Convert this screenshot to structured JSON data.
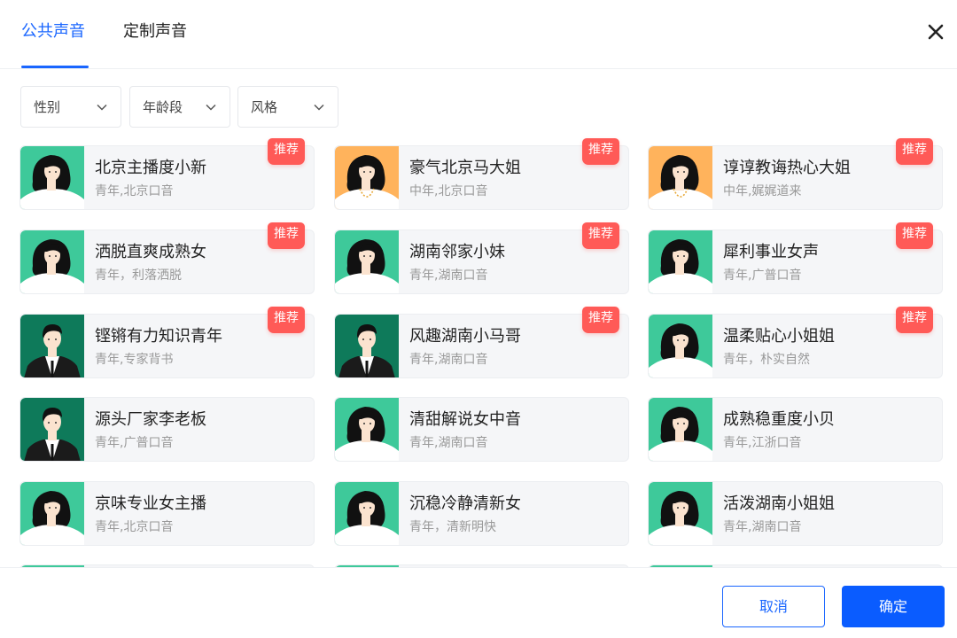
{
  "tabs": [
    {
      "label": "公共声音",
      "active": true
    },
    {
      "label": "定制声音",
      "active": false
    }
  ],
  "filters": [
    {
      "label": "性别"
    },
    {
      "label": "年龄段"
    },
    {
      "label": "风格"
    }
  ],
  "badge_text": "推荐",
  "voices": [
    {
      "name": "北京主播度小新",
      "desc": "青年,北京口音",
      "avatar": "young-woman",
      "recommended": true
    },
    {
      "name": "豪气北京马大姐",
      "desc": "中年,北京口音",
      "avatar": "middle-woman",
      "recommended": true
    },
    {
      "name": "谆谆教诲热心大姐",
      "desc": "中年,娓娓道来",
      "avatar": "middle-woman",
      "recommended": true
    },
    {
      "name": "洒脱直爽成熟女",
      "desc": "青年，利落洒脱",
      "avatar": "young-woman",
      "recommended": true
    },
    {
      "name": "湖南邻家小妹",
      "desc": "青年,湖南口音",
      "avatar": "young-woman",
      "recommended": true
    },
    {
      "name": "犀利事业女声",
      "desc": "青年,广普口音",
      "avatar": "young-woman",
      "recommended": true
    },
    {
      "name": "铿锵有力知识青年",
      "desc": "青年,专家背书",
      "avatar": "young-man",
      "recommended": true
    },
    {
      "name": "风趣湖南小马哥",
      "desc": "青年,湖南口音",
      "avatar": "young-man",
      "recommended": true
    },
    {
      "name": "温柔贴心小姐姐",
      "desc": "青年，朴实自然",
      "avatar": "young-woman",
      "recommended": true
    },
    {
      "name": "源头厂家李老板",
      "desc": "青年,广普口音",
      "avatar": "young-man",
      "recommended": false
    },
    {
      "name": "清甜解说女中音",
      "desc": "青年,湖南口音",
      "avatar": "young-woman",
      "recommended": false
    },
    {
      "name": "成熟稳重度小贝",
      "desc": "青年,江浙口音",
      "avatar": "young-woman",
      "recommended": false
    },
    {
      "name": "京味专业女主播",
      "desc": "青年,北京口音",
      "avatar": "young-woman",
      "recommended": false
    },
    {
      "name": "沉稳冷静清新女",
      "desc": "青年，清新明快",
      "avatar": "young-woman",
      "recommended": false
    },
    {
      "name": "活泼湖南小姐姐",
      "desc": "青年,湖南口音",
      "avatar": "young-woman",
      "recommended": false
    }
  ],
  "footer": {
    "cancel_label": "取消",
    "confirm_label": "确定"
  },
  "colors": {
    "accent": "#1a66ff",
    "primary_button": "#0a5cff",
    "badge": "#ff5a57",
    "avatar_green": "#3ec99a",
    "avatar_dark_green": "#0e7a5a",
    "avatar_orange": "#ffb35c"
  },
  "icons": {
    "close": "close-icon",
    "dropdown": "chevron-down-icon"
  }
}
